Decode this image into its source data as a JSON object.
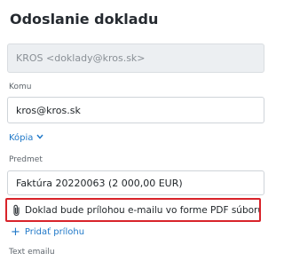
{
  "dialog": {
    "title": "Odoslanie dokladu"
  },
  "from": {
    "value": "KROS <doklady@kros.sk>"
  },
  "to": {
    "label": "Komu",
    "value": "kros@kros.sk"
  },
  "copy": {
    "label": "Kópia"
  },
  "subject": {
    "label": "Predmet",
    "value": "Faktúra 20220063 (2 000,00 EUR)"
  },
  "attachment": {
    "notice": "Doklad bude prílohou e-mailu vo forme PDF súboru",
    "highlight_color": "#d8232a"
  },
  "add_attachment": {
    "label": "Pridať prílohu"
  },
  "body_text": {
    "label": "Text emailu"
  },
  "colors": {
    "accent": "#1f78c8"
  }
}
